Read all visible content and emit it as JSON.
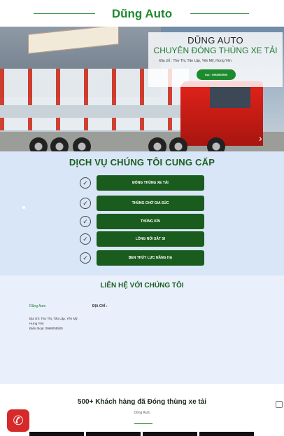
{
  "header": {
    "brand": "Dũng Auto"
  },
  "hero": {
    "title": "DŨNG AUTO",
    "subtitle": "CHUYÊN ĐÓNG THÙNG XE TẢI",
    "address": "Địa chỉ : Thư Thị, Tân Lập, Yên Mỹ, Hưng Yên",
    "call_label": "Gọi : 0968005500"
  },
  "services": {
    "title": "DỊCH VỤ CHÚNG TÔI CUNG CẤP",
    "items": [
      "ĐÓNG THÙNG XE TẢI",
      "THÙNG CHỞ GIA SÚC",
      "THÙNG KÍN",
      "LỒNG NỐI SẮT SI",
      "BEN THỦY LỰC NÂNG HẠ"
    ]
  },
  "contact": {
    "title": "LIÊN HỆ VỚI CHÚNG TÔI",
    "brand": "Dũng Auto",
    "address_label": "ĐỊA CHỈ :",
    "address_line": "Địa chỉ: Thư Thị, Tân Lập, Yên Mỹ,",
    "address_line2": "Hưng Yên",
    "phone_line": "Điện thoại: 0968005500"
  },
  "customers": {
    "title": "500+ Khách hàng đã Đóng thùng xe tải",
    "subtitle": "Dũng Auto"
  },
  "icons": {
    "check": "check-circle-icon",
    "phone": "phone-icon",
    "arrow": "arrow-icon"
  },
  "colors": {
    "brand_green": "#1e8a2e",
    "button_green": "#1a5c1e",
    "services_bg": "#d9e6f7",
    "phone_red": "#d62a2a"
  }
}
